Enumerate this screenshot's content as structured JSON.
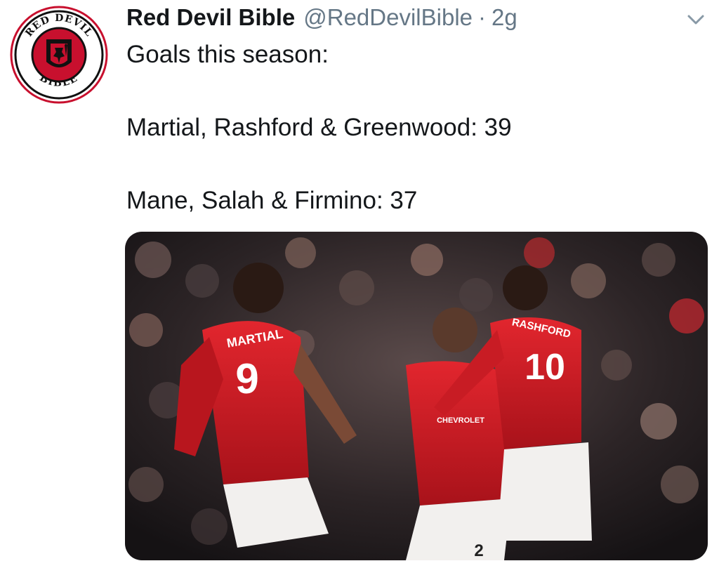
{
  "tweet": {
    "author_name": "Red Devil Bible",
    "handle": "@RedDevilBible",
    "separator": "·",
    "time": "2g",
    "lines": [
      "Goals this season:",
      "Martial, Rashford & Greenwood: 39",
      "Mane, Salah & Firmino: 37"
    ]
  },
  "avatar_logo": {
    "top_text": "RED DEVIL",
    "bottom_text": "BIBLE"
  },
  "media": {
    "jerseys": {
      "left_name": "MARTIAL",
      "left_number": "9",
      "right_name": "RASHFORD",
      "right_number": "10",
      "sponsor": "CHEVROLET",
      "bottom_number": "2"
    }
  },
  "icons": {
    "menu": "chevron-down-icon"
  },
  "colors": {
    "name": "#14171a",
    "secondary": "#657786",
    "jersey_red": "#d01e27",
    "logo_red": "#c8102e"
  }
}
